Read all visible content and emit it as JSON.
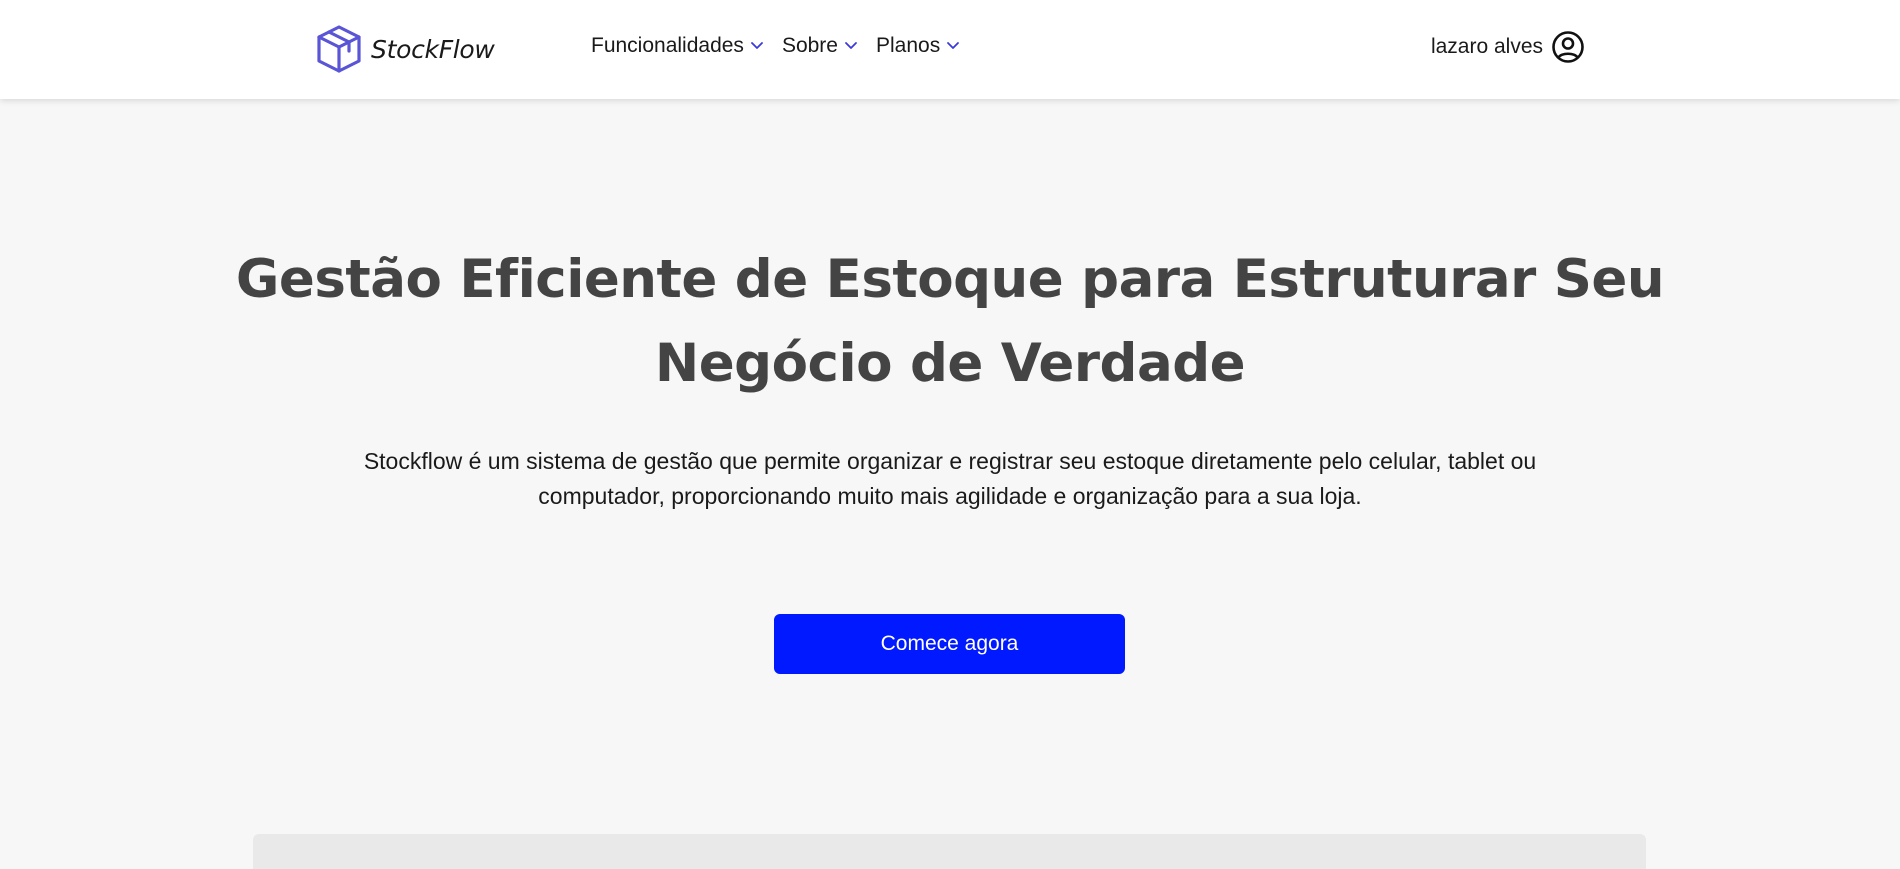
{
  "brand": {
    "name": "StockFlow",
    "accent_color": "#5a55d6"
  },
  "nav": {
    "items": [
      {
        "label": "Funcionalidades",
        "icon": "chevron-down-icon"
      },
      {
        "label": "Sobre",
        "icon": "chevron-down-icon"
      },
      {
        "label": "Planos",
        "icon": "chevron-down-icon"
      }
    ],
    "chevron_color": "#3b3bdb"
  },
  "user": {
    "name": "lazaro alves",
    "icon": "user-circle-icon"
  },
  "hero": {
    "title_line1": "Gestão Eficiente de Estoque para Estruturar Seu",
    "title_line2": "Negócio de Verdade",
    "description_line1": "Stockflow é um sistema de gestão que permite organizar e registrar seu estoque diretamente pelo celular, tablet ou",
    "description_line2": "computador, proporcionando muito mais agilidade e organização para a sua loja.",
    "cta_label": "Comece agora",
    "cta_color": "#0019ff"
  }
}
